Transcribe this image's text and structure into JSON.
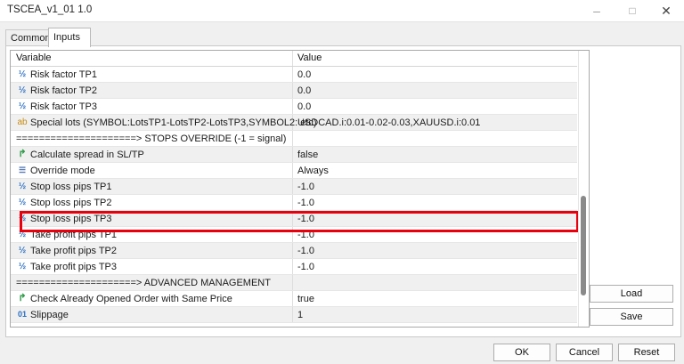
{
  "window": {
    "title": "TSCEA_v1_01 1.0"
  },
  "tabs": [
    {
      "label": "Common"
    },
    {
      "label": "Inputs"
    }
  ],
  "grid": {
    "headers": {
      "variable": "Variable",
      "value": "Value"
    },
    "rows": [
      {
        "icon": "fraction-icon",
        "variable": "Risk factor TP1",
        "value": "0.0"
      },
      {
        "icon": "fraction-icon",
        "variable": "Risk factor TP2",
        "value": "0.0"
      },
      {
        "icon": "fraction-icon",
        "variable": "Risk factor TP3",
        "value": "0.0"
      },
      {
        "icon": "string-icon",
        "variable": "Special lots (SYMBOL:LotsTP1-LotsTP2-LotsTP3,SYMBOL2: etc)",
        "value": "USDCAD.i:0.01-0.02-0.03,XAUUSD.i:0.01"
      },
      {
        "icon": "",
        "variable": "=====================> STOPS OVERRIDE (-1 = signal)",
        "value": ""
      },
      {
        "icon": "bool-arrow-icon",
        "variable": "Calculate spread in SL/TP",
        "value": "false"
      },
      {
        "icon": "enum-icon",
        "variable": "Override mode",
        "value": "Always"
      },
      {
        "icon": "fraction-icon",
        "variable": "Stop loss pips TP1",
        "value": "-1.0"
      },
      {
        "icon": "fraction-icon",
        "variable": "Stop loss pips TP2",
        "value": "-1.0"
      },
      {
        "icon": "fraction-icon",
        "variable": "Stop loss pips TP3",
        "value": "-1.0"
      },
      {
        "icon": "fraction-icon",
        "variable": "Take profit pips TP1",
        "value": "-1.0"
      },
      {
        "icon": "fraction-icon",
        "variable": "Take profit pips TP2",
        "value": "-1.0"
      },
      {
        "icon": "fraction-icon",
        "variable": "Take profit pips TP3",
        "value": "-1.0"
      },
      {
        "icon": "",
        "variable": "=====================> ADVANCED MANAGEMENT",
        "value": ""
      },
      {
        "icon": "bool-arrow-icon",
        "variable": "Check Already Opened Order with Same Price",
        "value": "true"
      },
      {
        "icon": "integer-icon",
        "variable": "Slippage",
        "value": "1"
      }
    ]
  },
  "side_buttons": {
    "load": "Load",
    "save": "Save"
  },
  "footer": {
    "ok": "OK",
    "cancel": "Cancel",
    "reset": "Reset"
  },
  "icons": {
    "fraction-icon": "½",
    "string-icon": "ab",
    "bool-arrow-icon": "↱",
    "enum-icon": "☰",
    "integer-icon": "01"
  },
  "colors": {
    "highlight_border": "#e8000c",
    "fraction_icon": "#2a6fc4",
    "string_icon": "#c78b12",
    "bool_icon": "#2b9b47"
  }
}
